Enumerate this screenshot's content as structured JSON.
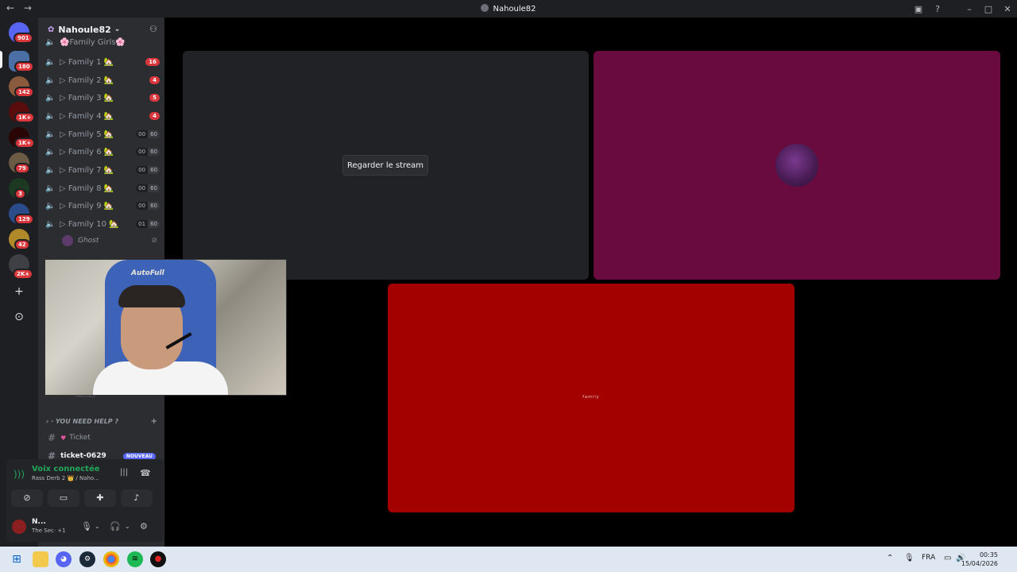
{
  "window": {
    "title": "Nahoule82",
    "back": "←",
    "forward": "→"
  },
  "rail": {
    "badges": [
      "901",
      "180",
      "142",
      "1K+",
      "1K+",
      "79",
      "3",
      "129",
      "42",
      "2K+"
    ],
    "add": "+",
    "discover": "⊙"
  },
  "guild": {
    "name": "Nahoule82",
    "chevron": "⌄",
    "invite_icon": "person-add"
  },
  "channels": {
    "top_partial": "🌸Family Girls🌸",
    "voice": [
      {
        "label": "▷ Family 1 🏡",
        "badge": "16"
      },
      {
        "label": "▷ Family 2 🏡",
        "badge": "4"
      },
      {
        "label": "▷ Family 3 🏡",
        "badge": "5"
      },
      {
        "label": "▷ Family 4 🏡",
        "badge": "4"
      },
      {
        "label": "▷ Family 5 🏡",
        "count": "00",
        "limit": "60"
      },
      {
        "label": "▷ Family 6 🏡",
        "count": "00",
        "limit": "60"
      },
      {
        "label": "▷ Family 7 🏡",
        "count": "00",
        "limit": "60"
      },
      {
        "label": "▷ Family 8 🏡",
        "count": "00",
        "limit": "60"
      },
      {
        "label": "▷ Family 9 🏡",
        "count": "00",
        "limit": "60"
      },
      {
        "label": "▷ Family 10 🏡",
        "count": "01",
        "limit": "60"
      }
    ],
    "ghost_user": "Ghost",
    "faded_user": "Aenzo",
    "category": "YOU NEED HELP ?",
    "ticket": "Ticket",
    "ticket_unread": "ticket-0629",
    "nouveau": "NOUVEAU"
  },
  "voice_panel": {
    "status": "Voix connectée",
    "sub": "Rass Derb 2 👑 / Naho...",
    "buttons": [
      "camera-off",
      "screen-share",
      "activities",
      "soundboard"
    ]
  },
  "user_panel": {
    "name": "N...",
    "activity": "The Sec· +1"
  },
  "stage": {
    "watch_button": "Regarder le stream",
    "red_tile_text": "family"
  },
  "webcam": {
    "chair_label": "AutoFull"
  },
  "taskbar": {
    "lang": "FRA",
    "time": "00:35",
    "date": "15/04/2026"
  }
}
